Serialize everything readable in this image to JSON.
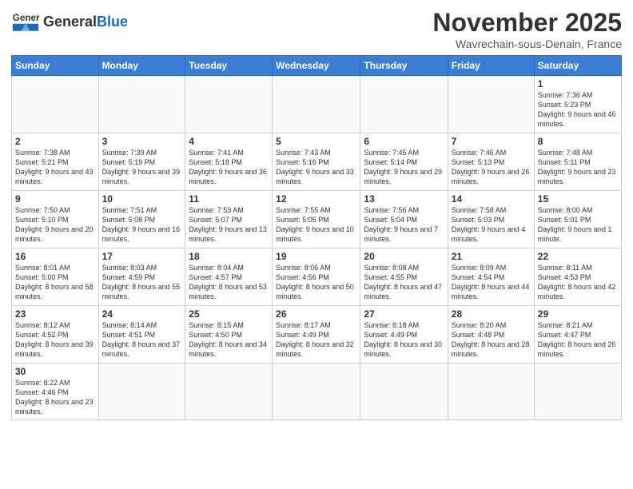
{
  "header": {
    "logo_general": "General",
    "logo_blue": "Blue",
    "month": "November 2025",
    "location": "Wavrechain-sous-Denain, France"
  },
  "weekdays": [
    "Sunday",
    "Monday",
    "Tuesday",
    "Wednesday",
    "Thursday",
    "Friday",
    "Saturday"
  ],
  "weeks": [
    [
      {
        "day": "",
        "info": ""
      },
      {
        "day": "",
        "info": ""
      },
      {
        "day": "",
        "info": ""
      },
      {
        "day": "",
        "info": ""
      },
      {
        "day": "",
        "info": ""
      },
      {
        "day": "",
        "info": ""
      },
      {
        "day": "1",
        "info": "Sunrise: 7:36 AM\nSunset: 5:23 PM\nDaylight: 9 hours and 46 minutes."
      }
    ],
    [
      {
        "day": "2",
        "info": "Sunrise: 7:38 AM\nSunset: 5:21 PM\nDaylight: 9 hours and 43 minutes."
      },
      {
        "day": "3",
        "info": "Sunrise: 7:39 AM\nSunset: 5:19 PM\nDaylight: 9 hours and 39 minutes."
      },
      {
        "day": "4",
        "info": "Sunrise: 7:41 AM\nSunset: 5:18 PM\nDaylight: 9 hours and 36 minutes."
      },
      {
        "day": "5",
        "info": "Sunrise: 7:43 AM\nSunset: 5:16 PM\nDaylight: 9 hours and 33 minutes."
      },
      {
        "day": "6",
        "info": "Sunrise: 7:45 AM\nSunset: 5:14 PM\nDaylight: 9 hours and 29 minutes."
      },
      {
        "day": "7",
        "info": "Sunrise: 7:46 AM\nSunset: 5:13 PM\nDaylight: 9 hours and 26 minutes."
      },
      {
        "day": "8",
        "info": "Sunrise: 7:48 AM\nSunset: 5:11 PM\nDaylight: 9 hours and 23 minutes."
      }
    ],
    [
      {
        "day": "9",
        "info": "Sunrise: 7:50 AM\nSunset: 5:10 PM\nDaylight: 9 hours and 20 minutes."
      },
      {
        "day": "10",
        "info": "Sunrise: 7:51 AM\nSunset: 5:08 PM\nDaylight: 9 hours and 16 minutes."
      },
      {
        "day": "11",
        "info": "Sunrise: 7:53 AM\nSunset: 5:07 PM\nDaylight: 9 hours and 13 minutes."
      },
      {
        "day": "12",
        "info": "Sunrise: 7:55 AM\nSunset: 5:05 PM\nDaylight: 9 hours and 10 minutes."
      },
      {
        "day": "13",
        "info": "Sunrise: 7:56 AM\nSunset: 5:04 PM\nDaylight: 9 hours and 7 minutes."
      },
      {
        "day": "14",
        "info": "Sunrise: 7:58 AM\nSunset: 5:03 PM\nDaylight: 9 hours and 4 minutes."
      },
      {
        "day": "15",
        "info": "Sunrise: 8:00 AM\nSunset: 5:01 PM\nDaylight: 9 hours and 1 minute."
      }
    ],
    [
      {
        "day": "16",
        "info": "Sunrise: 8:01 AM\nSunset: 5:00 PM\nDaylight: 8 hours and 58 minutes."
      },
      {
        "day": "17",
        "info": "Sunrise: 8:03 AM\nSunset: 4:59 PM\nDaylight: 8 hours and 55 minutes."
      },
      {
        "day": "18",
        "info": "Sunrise: 8:04 AM\nSunset: 4:57 PM\nDaylight: 8 hours and 53 minutes."
      },
      {
        "day": "19",
        "info": "Sunrise: 8:06 AM\nSunset: 4:56 PM\nDaylight: 8 hours and 50 minutes."
      },
      {
        "day": "20",
        "info": "Sunrise: 8:08 AM\nSunset: 4:55 PM\nDaylight: 8 hours and 47 minutes."
      },
      {
        "day": "21",
        "info": "Sunrise: 8:09 AM\nSunset: 4:54 PM\nDaylight: 8 hours and 44 minutes."
      },
      {
        "day": "22",
        "info": "Sunrise: 8:11 AM\nSunset: 4:53 PM\nDaylight: 8 hours and 42 minutes."
      }
    ],
    [
      {
        "day": "23",
        "info": "Sunrise: 8:12 AM\nSunset: 4:52 PM\nDaylight: 8 hours and 39 minutes."
      },
      {
        "day": "24",
        "info": "Sunrise: 8:14 AM\nSunset: 4:51 PM\nDaylight: 8 hours and 37 minutes."
      },
      {
        "day": "25",
        "info": "Sunrise: 8:15 AM\nSunset: 4:50 PM\nDaylight: 8 hours and 34 minutes."
      },
      {
        "day": "26",
        "info": "Sunrise: 8:17 AM\nSunset: 4:49 PM\nDaylight: 8 hours and 32 minutes."
      },
      {
        "day": "27",
        "info": "Sunrise: 8:18 AM\nSunset: 4:49 PM\nDaylight: 8 hours and 30 minutes."
      },
      {
        "day": "28",
        "info": "Sunrise: 8:20 AM\nSunset: 4:48 PM\nDaylight: 8 hours and 28 minutes."
      },
      {
        "day": "29",
        "info": "Sunrise: 8:21 AM\nSunset: 4:47 PM\nDaylight: 8 hours and 26 minutes."
      }
    ],
    [
      {
        "day": "30",
        "info": "Sunrise: 8:22 AM\nSunset: 4:46 PM\nDaylight: 8 hours and 23 minutes."
      },
      {
        "day": "",
        "info": ""
      },
      {
        "day": "",
        "info": ""
      },
      {
        "day": "",
        "info": ""
      },
      {
        "day": "",
        "info": ""
      },
      {
        "day": "",
        "info": ""
      },
      {
        "day": "",
        "info": ""
      }
    ]
  ]
}
